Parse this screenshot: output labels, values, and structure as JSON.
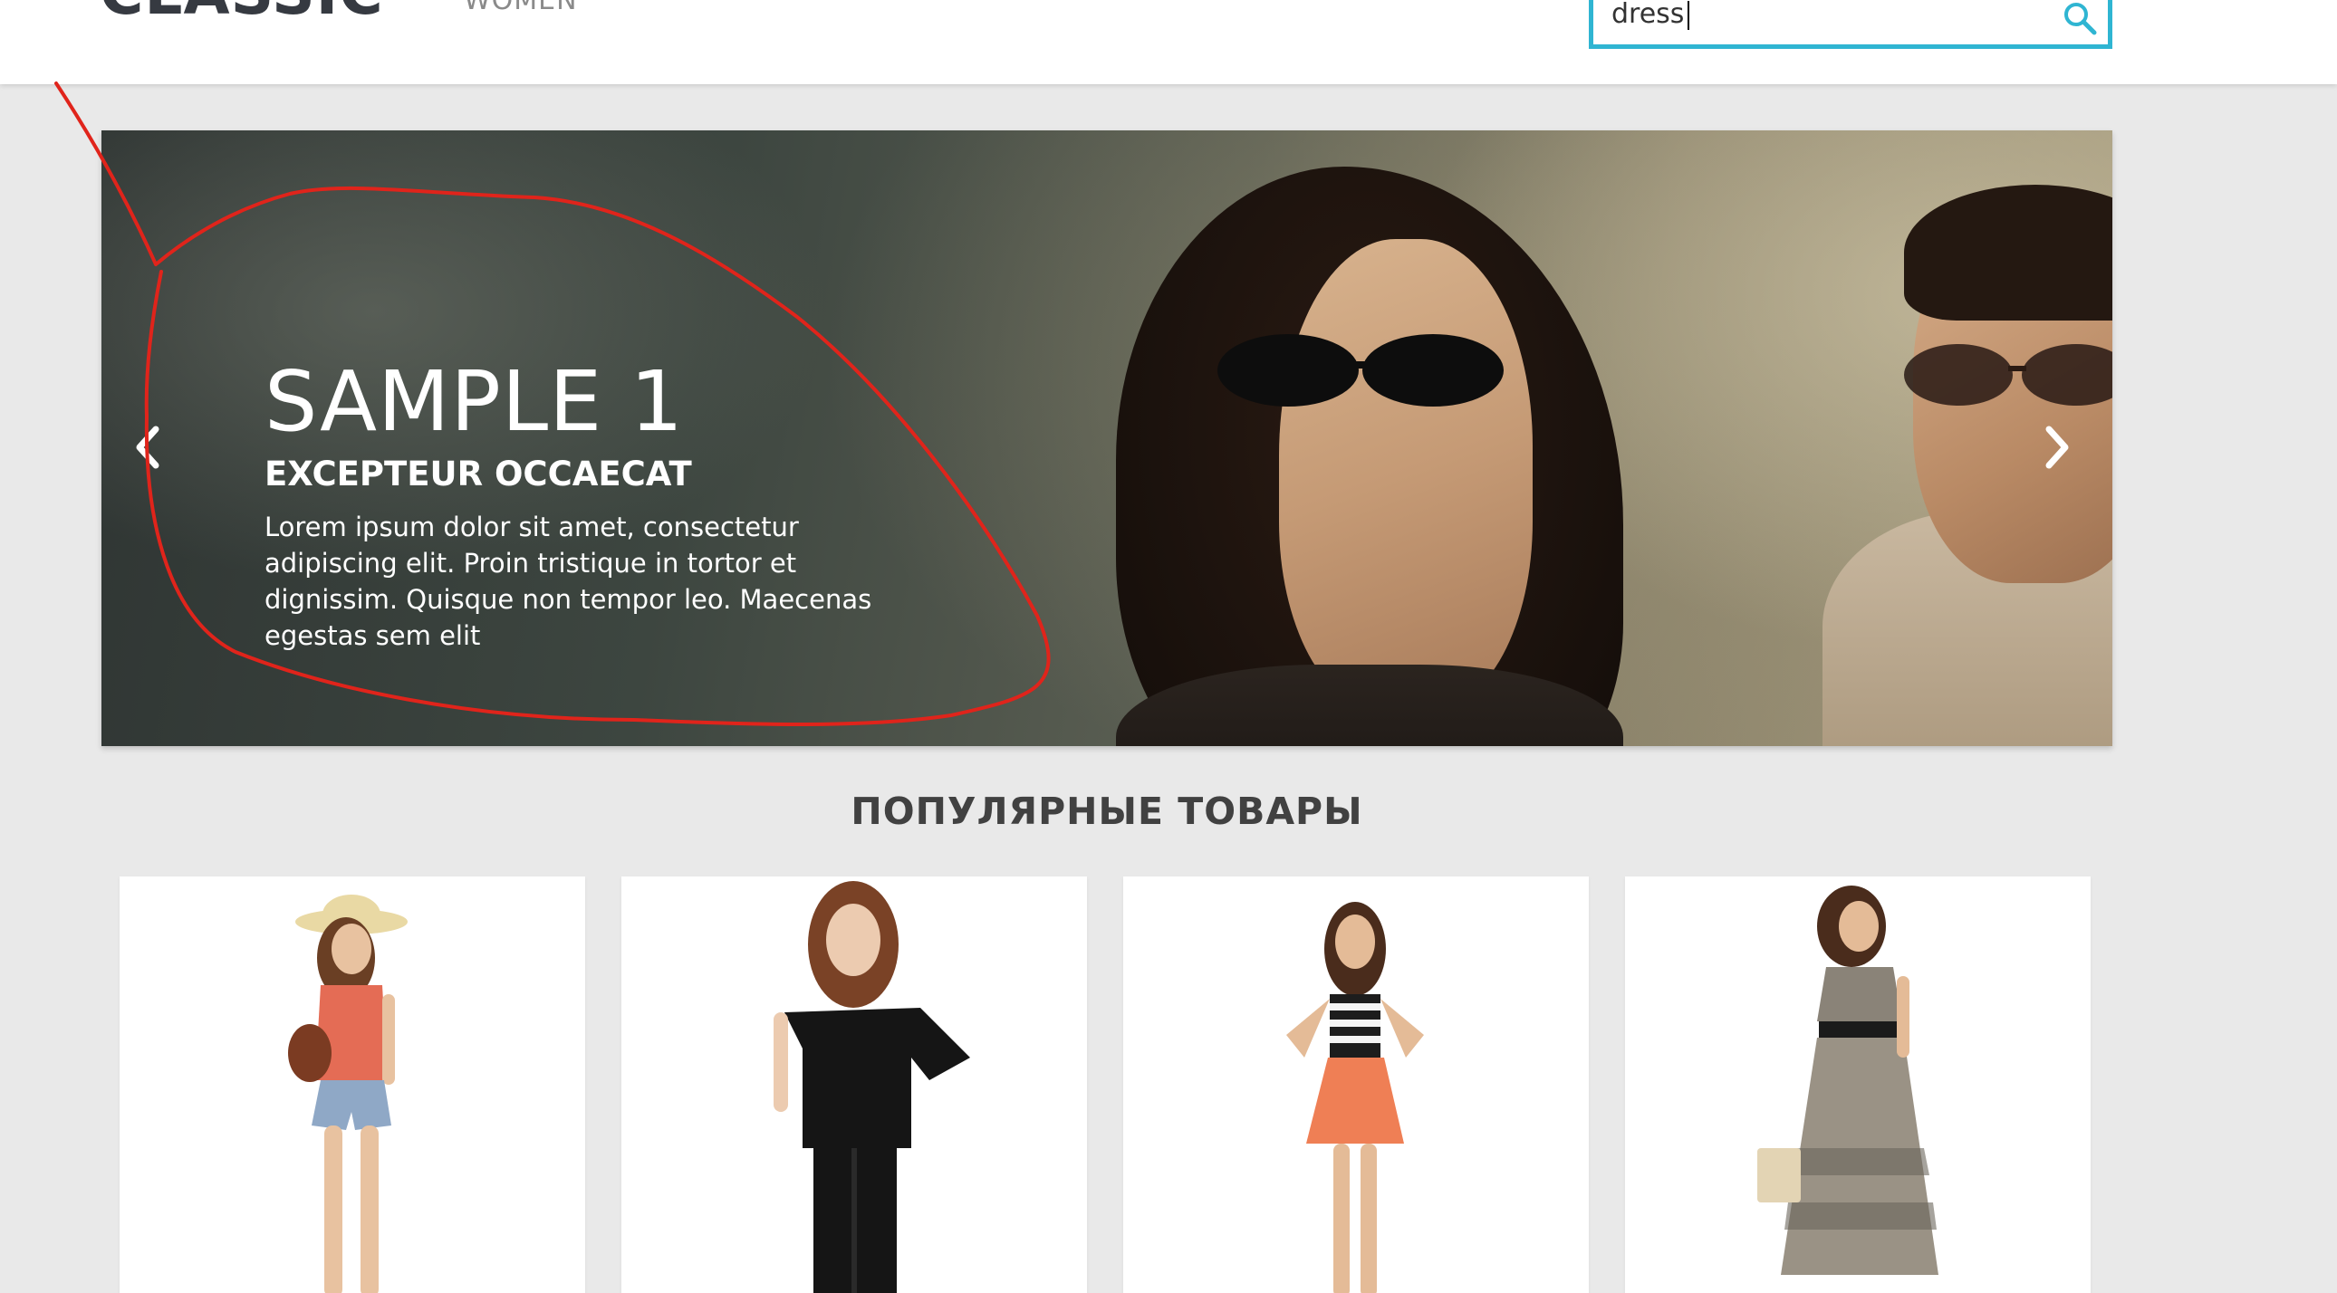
{
  "header": {
    "logo": "CLASSIC",
    "nav_women": "WOMEN",
    "search": {
      "value": "dress",
      "icon": "search-icon",
      "accent_color": "#2fb5d2"
    }
  },
  "slider": {
    "title": "SAMPLE 1",
    "subtitle": "EXCEPTEUR OCCAECAT",
    "text": "Lorem ipsum dolor sit amet, consectetur adipiscing elit. Proin tristique in tortor et dignissim. Quisque non tempor leo. Maecenas egestas sem elit",
    "prev_icon": "chevron-left-icon",
    "next_icon": "chevron-right-icon"
  },
  "annotation": {
    "color": "#e0241b"
  },
  "popular": {
    "title": "ПОПУЛЯРНЫЕ ТОВАРЫ",
    "products": [
      {
        "image": "woman-in-hat-with-orange-top-and-denim-shorts"
      },
      {
        "image": "woman-in-black-top-and-black-pants"
      },
      {
        "image": "woman-in-striped-top-and-orange-skirt"
      },
      {
        "image": "woman-in-printed-dress"
      }
    ]
  }
}
